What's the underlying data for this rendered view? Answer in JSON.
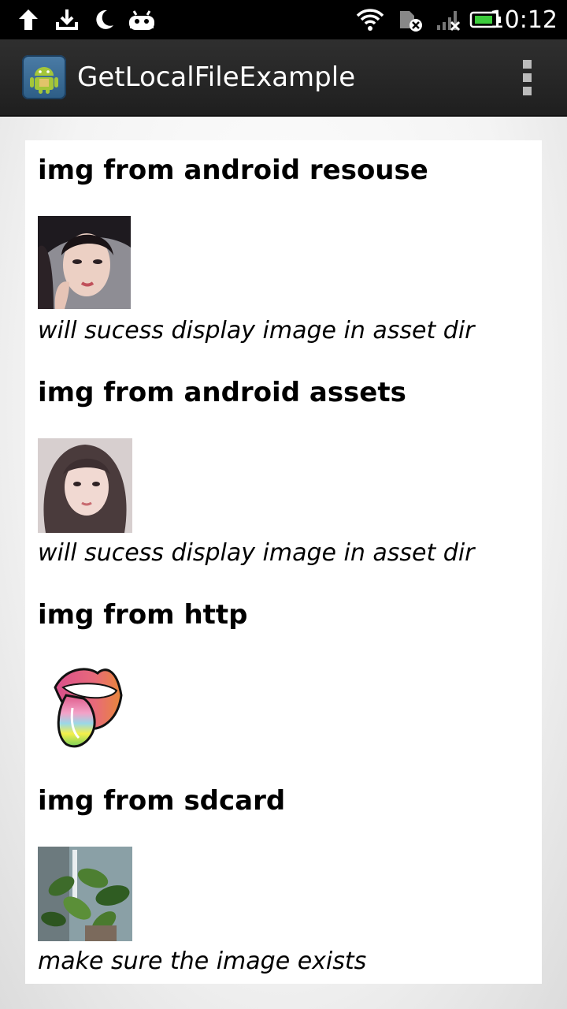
{
  "status_bar": {
    "time": "10:12",
    "icons": [
      "upload-icon",
      "download-icon",
      "moon-icon",
      "android-icon",
      "wifi-icon",
      "sim-error-icon",
      "signal-icon",
      "battery-icon"
    ]
  },
  "action_bar": {
    "app_title": "GetLocalFileExample",
    "app_icon": "android-app-icon",
    "overflow_icon": "overflow-menu-icon"
  },
  "sections": [
    {
      "heading": "img from android resouse",
      "image": "portrait-woman-1",
      "caption": "will sucess display image in asset dir"
    },
    {
      "heading": "img from android assets",
      "image": "portrait-woman-2",
      "caption": "will sucess display image in asset dir"
    },
    {
      "heading": "img from http",
      "image": "rolling-stones-tongue-logo",
      "caption": ""
    },
    {
      "heading": "img from sdcard",
      "image": "plant-photo",
      "caption": "make sure the image exists"
    }
  ],
  "colors": {
    "status_bar_bg": "#000000",
    "action_bar_bg": "#262626",
    "card_bg": "#ffffff"
  }
}
